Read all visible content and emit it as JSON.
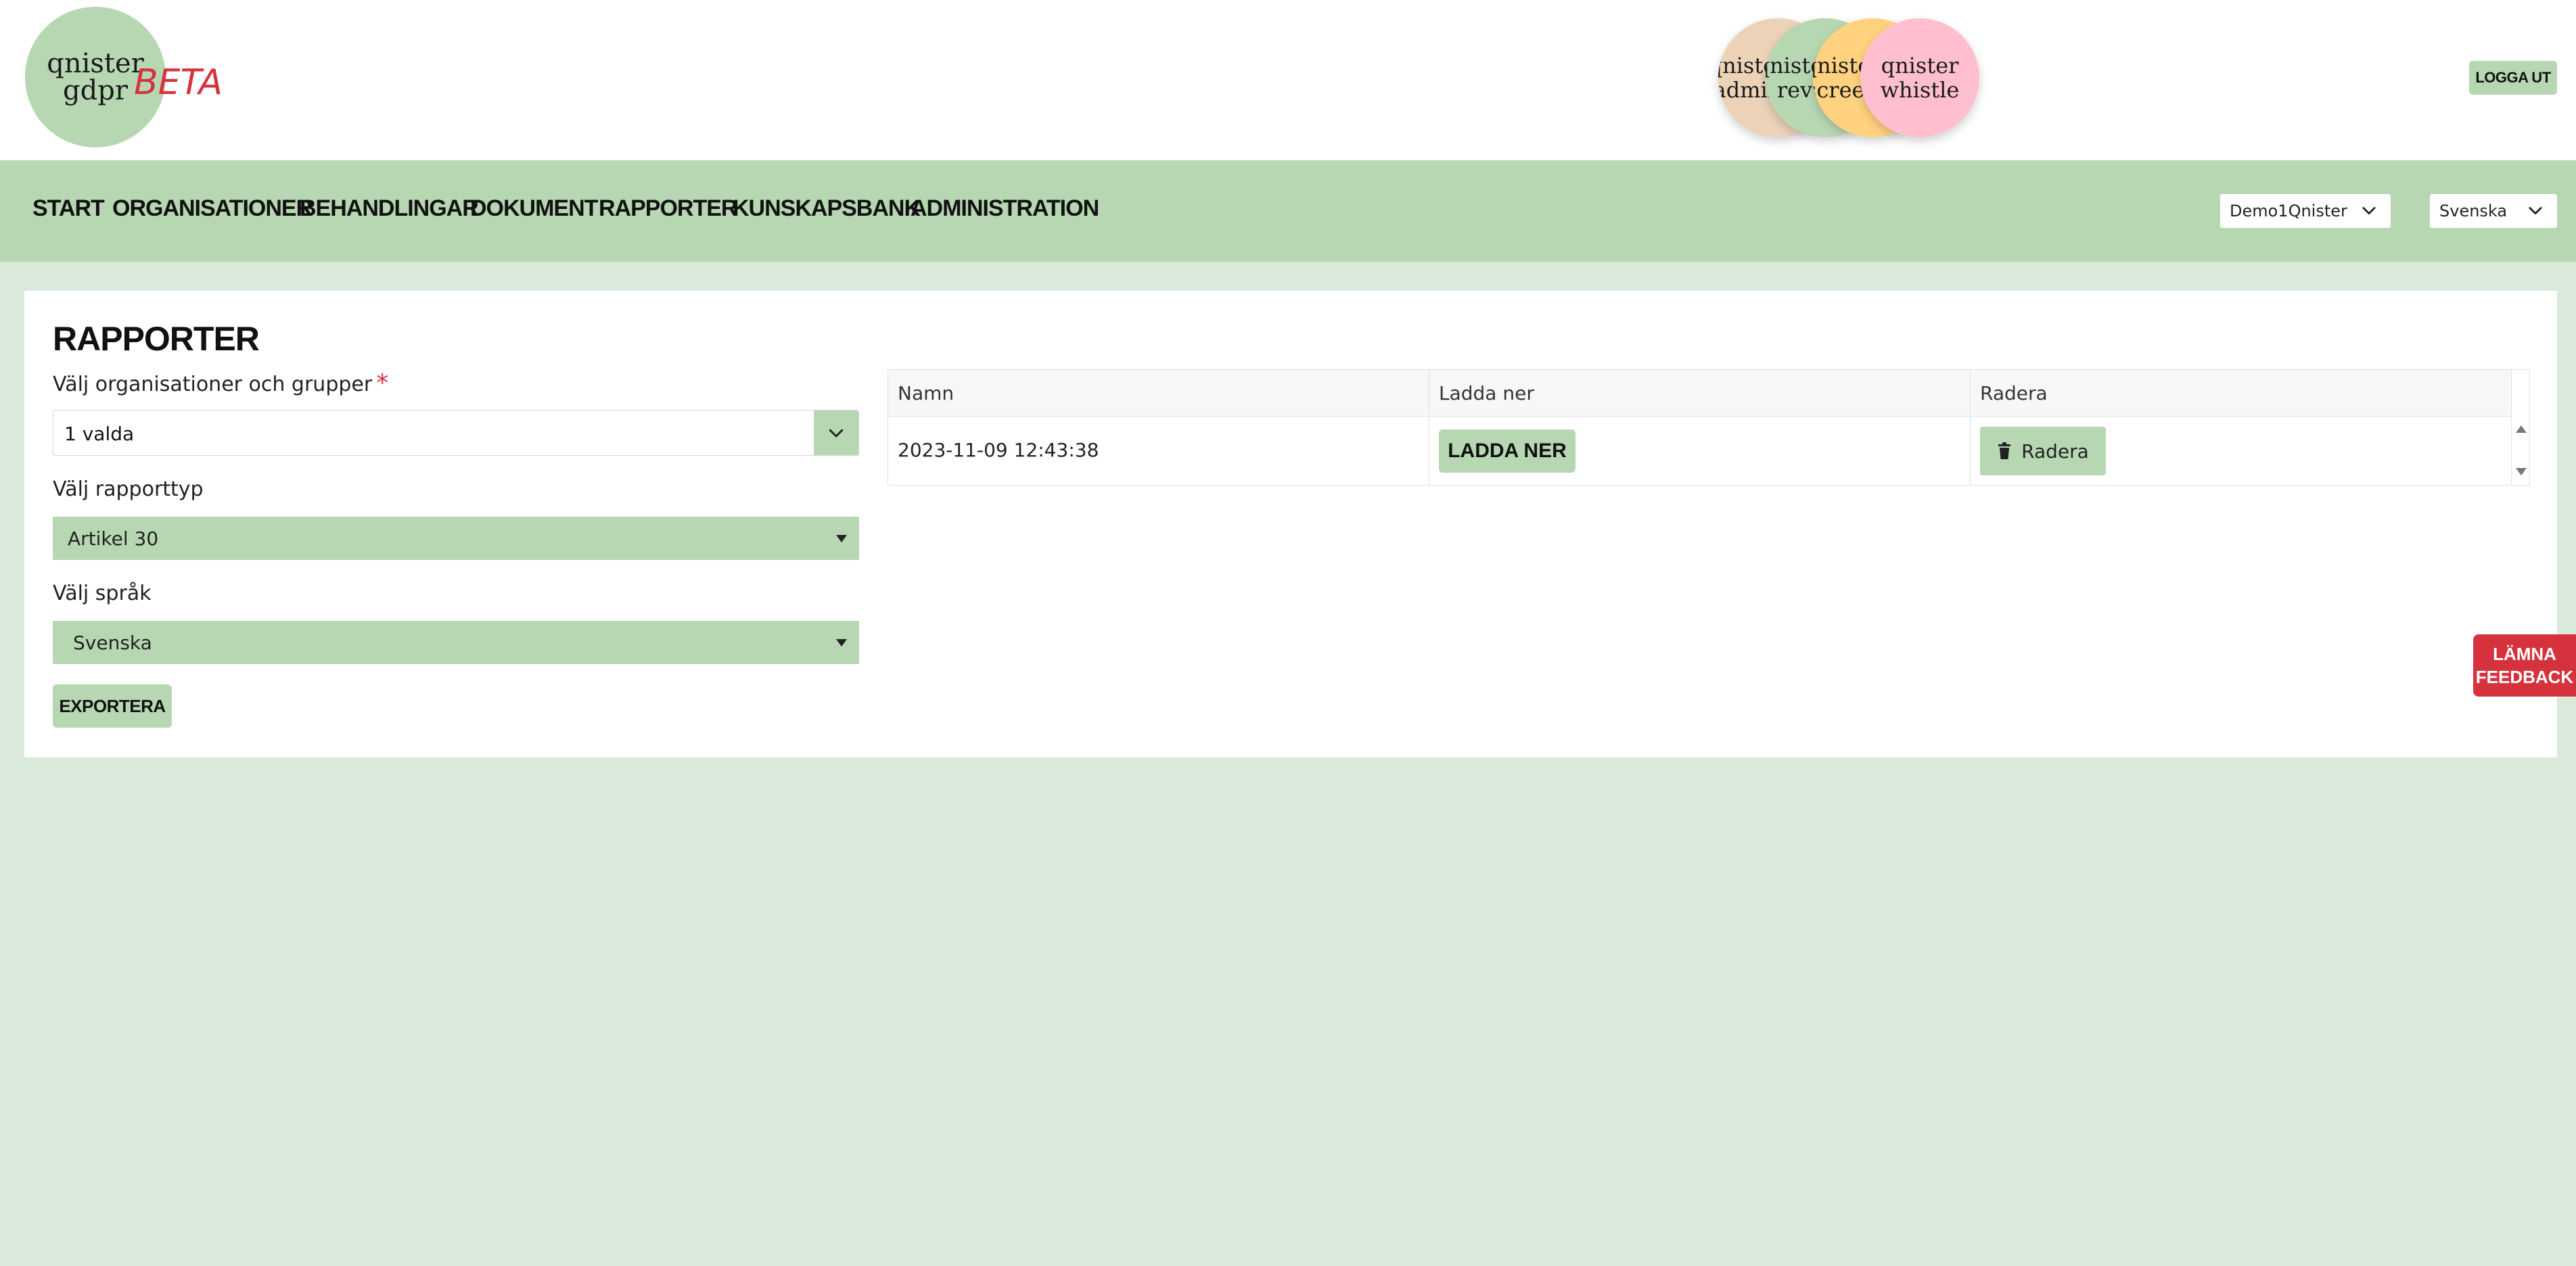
{
  "header": {
    "logo": {
      "line1": "qnister",
      "line2": "gdpr",
      "badge": "BETA"
    },
    "apps": [
      {
        "line1": "qnister",
        "line2": "admin"
      },
      {
        "line1": "qnister",
        "line2": "rev"
      },
      {
        "line1": "qnister",
        "line2": "screen"
      },
      {
        "line1": "qnister",
        "line2": "whistle"
      }
    ],
    "logout_label": "LOGGA UT"
  },
  "nav": {
    "items": [
      "START",
      "ORGANISATIONER",
      "BEHANDLINGAR",
      "DOKUMENT",
      "RAPPORTER",
      "KUNSKAPSBANK",
      "ADMINISTRATION"
    ],
    "org_select": "Demo1Qnister",
    "language_select": "Svenska"
  },
  "main": {
    "title": "RAPPORTER",
    "org_field": {
      "label": "Välj organisationer och grupper",
      "required_mark": "*",
      "value": "1 valda"
    },
    "report_type": {
      "label": "Välj rapporttyp",
      "value": "Artikel 30"
    },
    "language": {
      "label": "Välj språk",
      "value": "Svenska"
    },
    "export_label": "EXPORTERA",
    "table": {
      "headers": [
        "Namn",
        "Ladda ner",
        "Radera"
      ],
      "rows": [
        {
          "name": "2023-11-09 12:43:38",
          "download_label": "LADDA NER",
          "delete_label": "Radera"
        }
      ]
    }
  },
  "feedback": {
    "line1": "LÄMNA",
    "line2": "FEEDBACK"
  },
  "colors": {
    "brand_green": "#b7d7b3",
    "page_bg": "#d9eada",
    "accent_red": "#d6323e"
  }
}
